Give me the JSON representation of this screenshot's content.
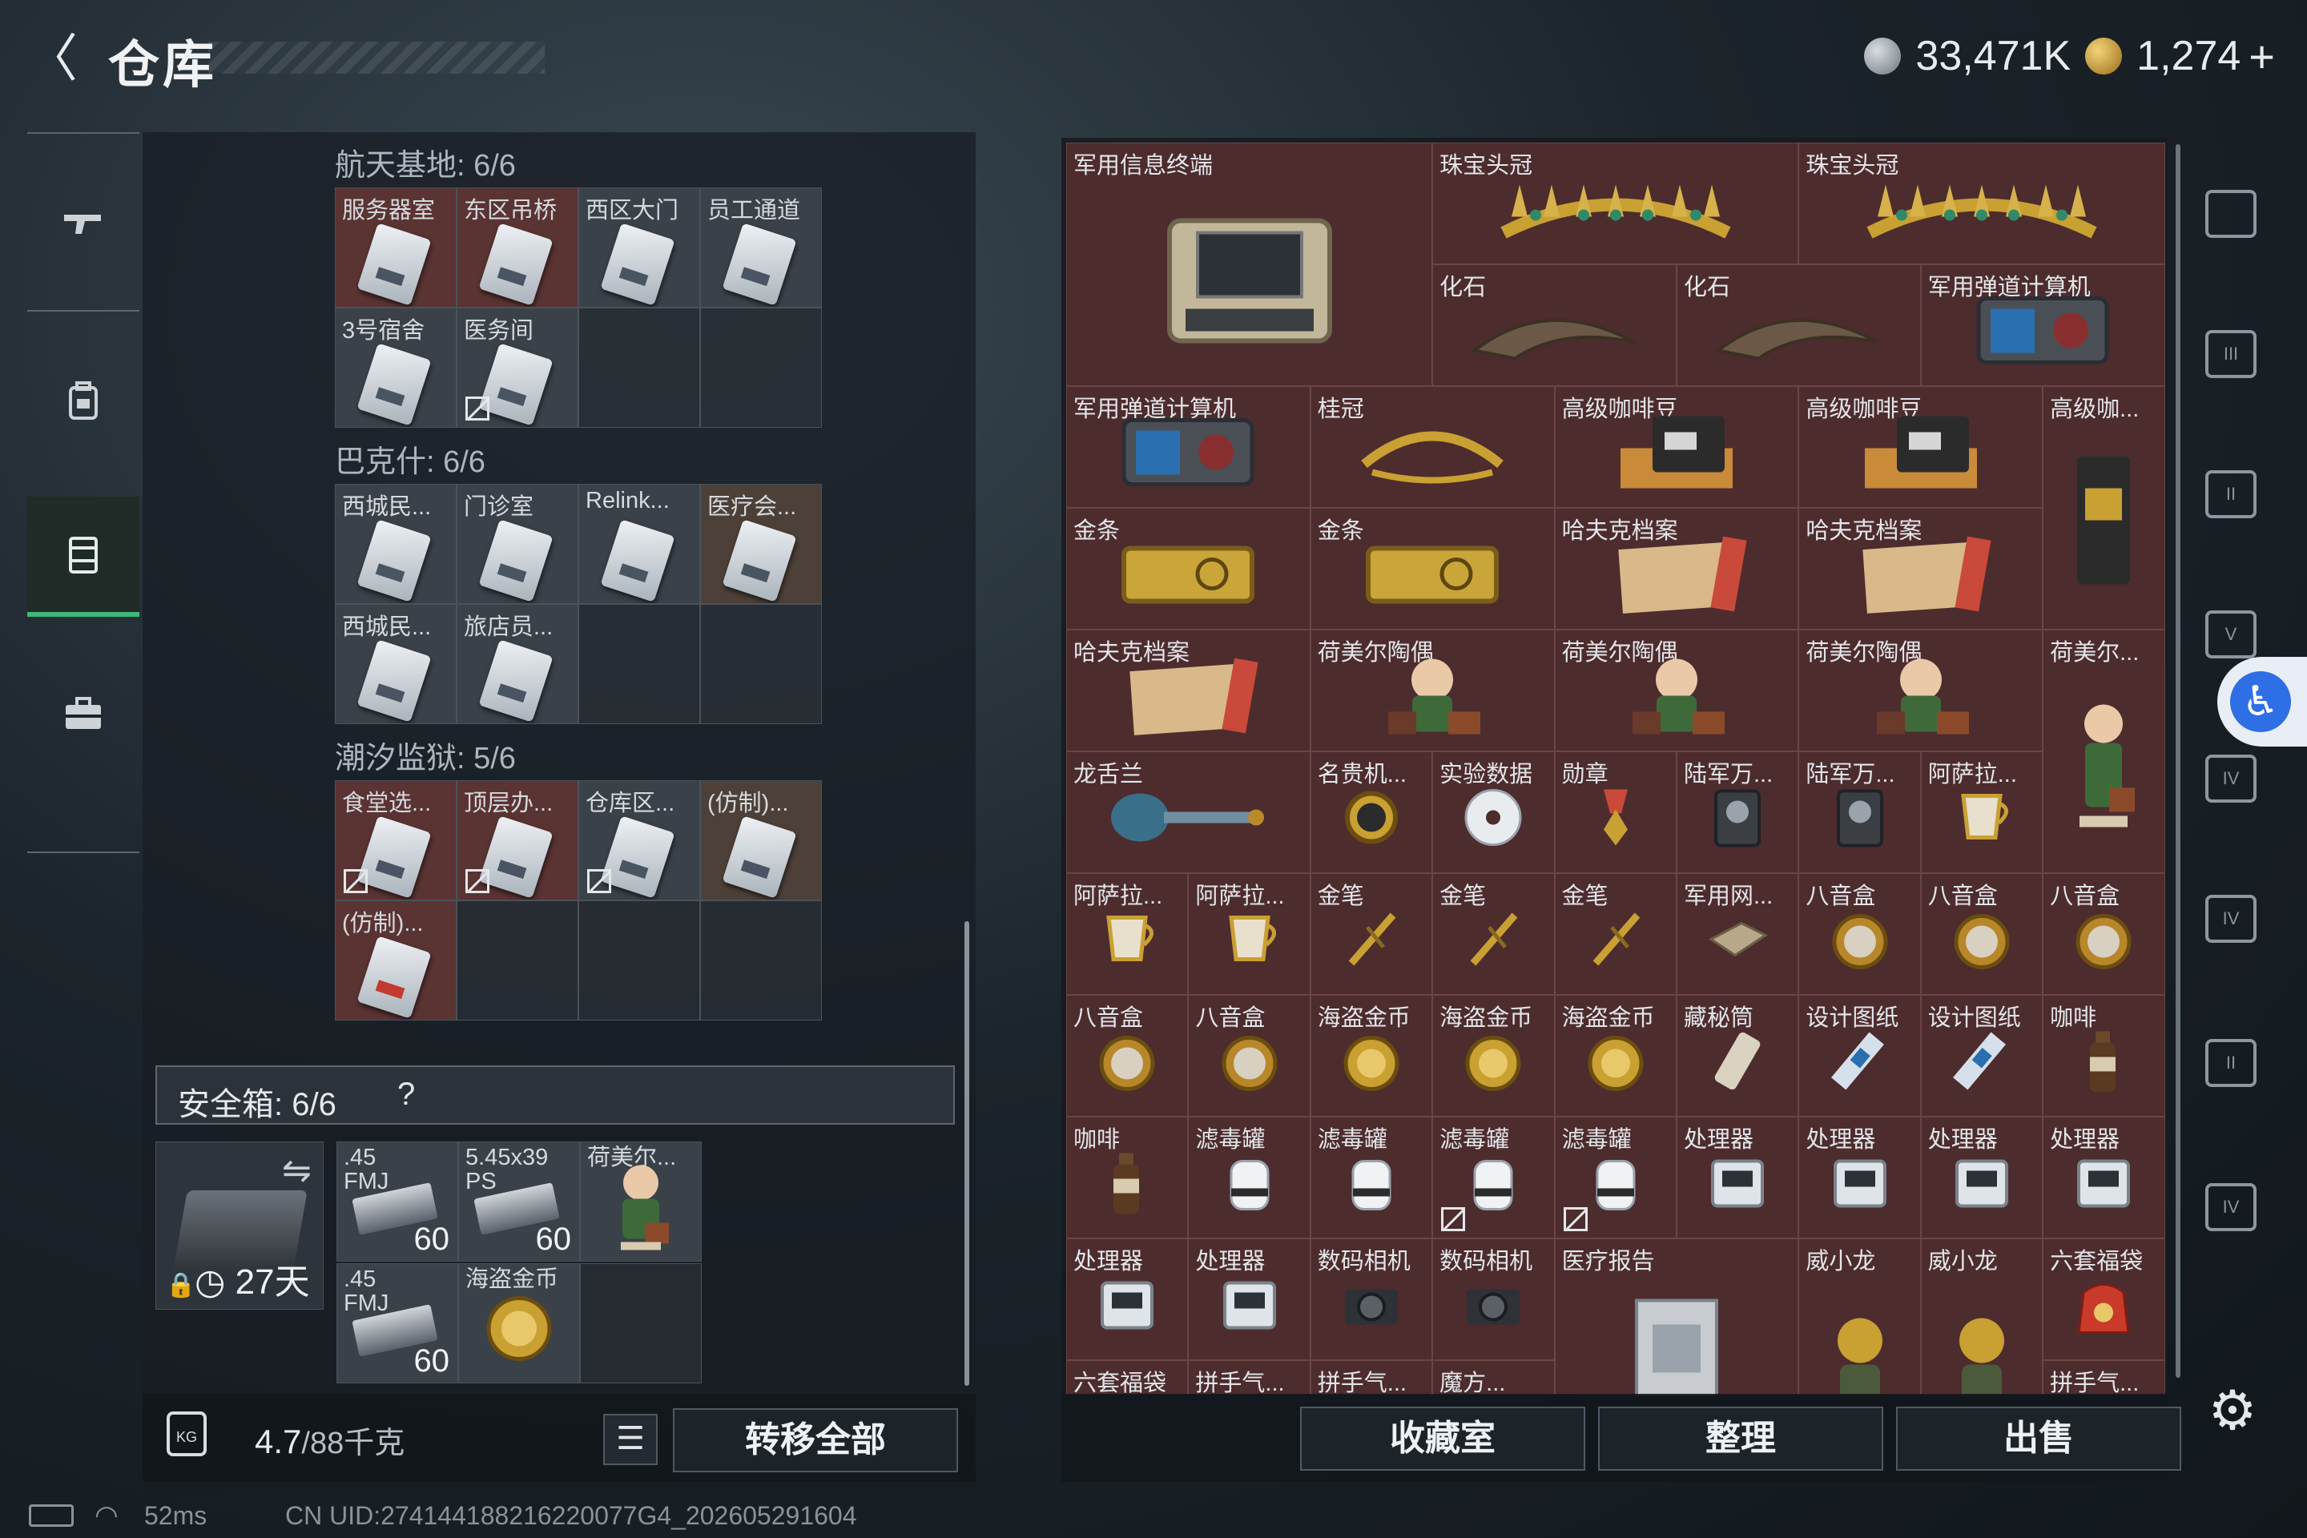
{
  "header": {
    "back_glyph": "〈",
    "title": "仓库",
    "currency_silver": "33,471K",
    "currency_gold": "1,274",
    "currency_plus": "+"
  },
  "left_nav": {
    "icons": [
      "gun-icon",
      "backpack-icon",
      "stash-icon",
      "toolbox-icon"
    ],
    "active_index": 2
  },
  "stash": {
    "sections": [
      {
        "title": "航天基地: 6/6",
        "cards": [
          {
            "label": "服务器室",
            "bg": "red",
            "nobind": false
          },
          {
            "label": "东区吊桥",
            "bg": "red",
            "nobind": false
          },
          {
            "label": "西区大门",
            "bg": "grey",
            "nobind": false
          },
          {
            "label": "员工通道",
            "bg": "grey",
            "nobind": false
          },
          {
            "label": "3号宿舍",
            "bg": "grey",
            "nobind": false
          },
          {
            "label": "医务间",
            "bg": "grey",
            "nobind": true
          }
        ]
      },
      {
        "title": "巴克什: 6/6",
        "cards": [
          {
            "label": "西城民...",
            "bg": "grey",
            "nobind": false
          },
          {
            "label": "门诊室",
            "bg": "grey",
            "nobind": false
          },
          {
            "label": "Relink...",
            "bg": "grey",
            "nobind": false
          },
          {
            "label": "医疗会...",
            "bg": "brown",
            "nobind": false
          },
          {
            "label": "西城民...",
            "bg": "grey",
            "nobind": false
          },
          {
            "label": "旅店员...",
            "bg": "grey",
            "nobind": false
          }
        ]
      },
      {
        "title": "潮汐监狱: 5/6",
        "cards": [
          {
            "label": "食堂选...",
            "bg": "red",
            "nobind": true
          },
          {
            "label": "顶层办...",
            "bg": "red",
            "nobind": true
          },
          {
            "label": "仓库区...",
            "bg": "grey",
            "nobind": true
          },
          {
            "label": "(仿制)...",
            "bg": "brown",
            "nobind": false
          },
          {
            "label": "(仿制)...",
            "bg": "red",
            "nobind": false,
            "red_card": true
          }
        ]
      }
    ]
  },
  "safebox": {
    "title": "安全箱:  6/6",
    "help": "?",
    "days": "27天",
    "swap_glyph": "⇋",
    "items": [
      {
        "label": ".45\nFMJ",
        "count": "60",
        "type": "ammo"
      },
      {
        "label": "5.45x39\nPS",
        "count": "60",
        "type": "ammo"
      },
      {
        "label": "荷美尔...",
        "count": "",
        "type": "figurine"
      },
      {
        "label": ".45\nFMJ",
        "count": "60",
        "type": "ammo"
      },
      {
        "label": "海盗金币",
        "count": "",
        "type": "coin"
      }
    ]
  },
  "bottom_left": {
    "kg_label": "KG",
    "weight_current": "4.7",
    "weight_max": "/88千克",
    "list_glyph": "☰",
    "transfer_all": "转移全部"
  },
  "loot_grid": [
    {
      "label": "军用信息终端",
      "col": 1,
      "row": 1,
      "w": 3,
      "h": 2,
      "pic": "terminal"
    },
    {
      "label": "珠宝头冠",
      "col": 4,
      "row": 1,
      "w": 3,
      "h": 1,
      "pic": "tiara"
    },
    {
      "label": "珠宝头冠",
      "col": 7,
      "row": 1,
      "w": 3,
      "h": 1,
      "pic": "tiara"
    },
    {
      "label": "化石",
      "col": 4,
      "row": 2,
      "w": 2,
      "h": 1,
      "pic": "fossil"
    },
    {
      "label": "化石",
      "col": 6,
      "row": 2,
      "w": 2,
      "h": 1,
      "pic": "fossil"
    },
    {
      "label": "军用弹道计算机",
      "col": 8,
      "row": 2,
      "w": 2,
      "h": 1,
      "pic": "computer"
    },
    {
      "label": "军用弹道计算机",
      "col": 1,
      "row": 3,
      "w": 2,
      "h": 1,
      "pic": "computer"
    },
    {
      "label": "桂冠",
      "col": 3,
      "row": 3,
      "w": 2,
      "h": 1,
      "pic": "laurel"
    },
    {
      "label": "高级咖啡豆",
      "col": 5,
      "row": 3,
      "w": 2,
      "h": 1,
      "pic": "coffeebag"
    },
    {
      "label": "高级咖啡豆",
      "col": 7,
      "row": 3,
      "w": 2,
      "h": 1,
      "pic": "coffeebag"
    },
    {
      "label": "高级咖...",
      "col": 9,
      "row": 3,
      "w": 1,
      "h": 2,
      "pic": "coffeebagtall"
    },
    {
      "label": "金条",
      "col": 1,
      "row": 4,
      "w": 2,
      "h": 1,
      "pic": "goldbar"
    },
    {
      "label": "金条",
      "col": 3,
      "row": 4,
      "w": 2,
      "h": 1,
      "pic": "goldbar"
    },
    {
      "label": "哈夫克档案",
      "col": 5,
      "row": 4,
      "w": 2,
      "h": 1,
      "pic": "file"
    },
    {
      "label": "哈夫克档案",
      "col": 7,
      "row": 4,
      "w": 2,
      "h": 1,
      "pic": "file"
    },
    {
      "label": "哈夫克档案",
      "col": 1,
      "row": 5,
      "w": 2,
      "h": 1,
      "pic": "file"
    },
    {
      "label": "荷美尔陶偶",
      "col": 3,
      "row": 5,
      "w": 2,
      "h": 1,
      "pic": "figurine"
    },
    {
      "label": "荷美尔陶偶",
      "col": 5,
      "row": 5,
      "w": 2,
      "h": 1,
      "pic": "figurine"
    },
    {
      "label": "荷美尔陶偶",
      "col": 7,
      "row": 5,
      "w": 2,
      "h": 1,
      "pic": "figurine"
    },
    {
      "label": "荷美尔...",
      "col": 9,
      "row": 5,
      "w": 1,
      "h": 2,
      "pic": "figurinetall"
    },
    {
      "label": "龙舌兰",
      "col": 1,
      "row": 6,
      "w": 2,
      "h": 1,
      "pic": "tequila"
    },
    {
      "label": "名贵机...",
      "col": 3,
      "row": 6,
      "w": 1,
      "h": 1,
      "pic": "watch"
    },
    {
      "label": "实验数据",
      "col": 4,
      "row": 6,
      "w": 1,
      "h": 1,
      "pic": "disc"
    },
    {
      "label": "勋章",
      "col": 5,
      "row": 6,
      "w": 1,
      "h": 1,
      "pic": "medal"
    },
    {
      "label": "陆军万...",
      "col": 6,
      "row": 6,
      "w": 1,
      "h": 1,
      "pic": "meter"
    },
    {
      "label": "陆军万...",
      "col": 7,
      "row": 6,
      "w": 1,
      "h": 1,
      "pic": "meter"
    },
    {
      "label": "阿萨拉...",
      "col": 8,
      "row": 6,
      "w": 1,
      "h": 1,
      "pic": "cup"
    },
    {
      "label": "阿萨拉...",
      "col": 1,
      "row": 7,
      "w": 1,
      "h": 1,
      "pic": "cup"
    },
    {
      "label": "阿萨拉...",
      "col": 2,
      "row": 7,
      "w": 1,
      "h": 1,
      "pic": "cup"
    },
    {
      "label": "金笔",
      "col": 3,
      "row": 7,
      "w": 1,
      "h": 1,
      "pic": "pen"
    },
    {
      "label": "金笔",
      "col": 4,
      "row": 7,
      "w": 1,
      "h": 1,
      "pic": "pen"
    },
    {
      "label": "金笔",
      "col": 5,
      "row": 7,
      "w": 1,
      "h": 1,
      "pic": "pen"
    },
    {
      "label": "军用网...",
      "col": 6,
      "row": 7,
      "w": 1,
      "h": 1,
      "pic": "router"
    },
    {
      "label": "八音盒",
      "col": 7,
      "row": 7,
      "w": 1,
      "h": 1,
      "pic": "musicbox"
    },
    {
      "label": "八音盒",
      "col": 8,
      "row": 7,
      "w": 1,
      "h": 1,
      "pic": "musicbox"
    },
    {
      "label": "八音盒",
      "col": 9,
      "row": 7,
      "w": 1,
      "h": 1,
      "pic": "musicbox"
    },
    {
      "label": "八音盒",
      "col": 1,
      "row": 8,
      "w": 1,
      "h": 1,
      "pic": "musicbox"
    },
    {
      "label": "八音盒",
      "col": 2,
      "row": 8,
      "w": 1,
      "h": 1,
      "pic": "musicbox"
    },
    {
      "label": "海盗金币",
      "col": 3,
      "row": 8,
      "w": 1,
      "h": 1,
      "pic": "coin"
    },
    {
      "label": "海盗金币",
      "col": 4,
      "row": 8,
      "w": 1,
      "h": 1,
      "pic": "coin"
    },
    {
      "label": "海盗金币",
      "col": 5,
      "row": 8,
      "w": 1,
      "h": 1,
      "pic": "coin"
    },
    {
      "label": "藏秘筒",
      "col": 6,
      "row": 8,
      "w": 1,
      "h": 1,
      "pic": "cylinder"
    },
    {
      "label": "设计图纸",
      "col": 7,
      "row": 8,
      "w": 1,
      "h": 1,
      "pic": "blueprint"
    },
    {
      "label": "设计图纸",
      "col": 8,
      "row": 8,
      "w": 1,
      "h": 1,
      "pic": "blueprint"
    },
    {
      "label": "咖啡",
      "col": 9,
      "row": 8,
      "w": 1,
      "h": 1,
      "pic": "bottle"
    },
    {
      "label": "咖啡",
      "col": 1,
      "row": 9,
      "w": 1,
      "h": 1,
      "pic": "bottle"
    },
    {
      "label": "滤毒罐",
      "col": 2,
      "row": 9,
      "w": 1,
      "h": 1,
      "pic": "filter"
    },
    {
      "label": "滤毒罐",
      "col": 3,
      "row": 9,
      "w": 1,
      "h": 1,
      "pic": "filter"
    },
    {
      "label": "滤毒罐",
      "col": 4,
      "row": 9,
      "w": 1,
      "h": 1,
      "pic": "filter",
      "nobind": true
    },
    {
      "label": "滤毒罐",
      "col": 5,
      "row": 9,
      "w": 1,
      "h": 1,
      "pic": "filter",
      "nobind": true
    },
    {
      "label": "处理器",
      "col": 6,
      "row": 9,
      "w": 1,
      "h": 1,
      "pic": "cpu"
    },
    {
      "label": "处理器",
      "col": 7,
      "row": 9,
      "w": 1,
      "h": 1,
      "pic": "cpu"
    },
    {
      "label": "处理器",
      "col": 8,
      "row": 9,
      "w": 1,
      "h": 1,
      "pic": "cpu"
    },
    {
      "label": "处理器",
      "col": 9,
      "row": 9,
      "w": 1,
      "h": 1,
      "pic": "cpu"
    },
    {
      "label": "处理器",
      "col": 1,
      "row": 10,
      "w": 1,
      "h": 1,
      "pic": "cpu"
    },
    {
      "label": "处理器",
      "col": 2,
      "row": 10,
      "w": 1,
      "h": 1,
      "pic": "cpu"
    },
    {
      "label": "数码相机",
      "col": 3,
      "row": 10,
      "w": 1,
      "h": 1,
      "pic": "camera"
    },
    {
      "label": "数码相机",
      "col": 4,
      "row": 10,
      "w": 1,
      "h": 1,
      "pic": "camera"
    },
    {
      "label": "医疗报告",
      "col": 5,
      "row": 10,
      "w": 2,
      "h": 2,
      "pic": "report"
    },
    {
      "label": "威小龙",
      "col": 7,
      "row": 10,
      "w": 1,
      "h": 2,
      "pic": "dragon"
    },
    {
      "label": "威小龙",
      "col": 8,
      "row": 10,
      "w": 1,
      "h": 2,
      "pic": "dragon"
    },
    {
      "label": "六套福袋",
      "col": 9,
      "row": 10,
      "w": 1,
      "h": 1,
      "pic": "luckybag"
    },
    {
      "label": "六套福袋",
      "col": 1,
      "row": 11,
      "w": 1,
      "h": 1,
      "pic": "luckybag"
    },
    {
      "label": "拼手气...",
      "col": 2,
      "row": 11,
      "w": 1,
      "h": 1,
      "pic": "luckybag"
    },
    {
      "label": "拼手气...",
      "col": 3,
      "row": 11,
      "w": 1,
      "h": 1,
      "pic": "luckybag"
    },
    {
      "label": "魔方...",
      "col": 4,
      "row": 11,
      "w": 1,
      "h": 1,
      "pic": "cube"
    },
    {
      "label": "拼手气...",
      "col": 9,
      "row": 11,
      "w": 1,
      "h": 1,
      "pic": "luckybag"
    }
  ],
  "right_buttons": {
    "collection": "收藏室",
    "sort": "整理",
    "sell": "出售"
  },
  "right_side_nav": [
    {
      "name": "stash-tab-1-icon",
      "label": ""
    },
    {
      "name": "stash-tab-III-icon",
      "label": "III"
    },
    {
      "name": "stash-tab-II-icon",
      "label": "II"
    },
    {
      "name": "stash-tab-V-icon",
      "label": "V"
    },
    {
      "name": "stash-tab-IV-icon",
      "label": "IV"
    },
    {
      "name": "stash-tab-IV-b-icon",
      "label": "IV"
    },
    {
      "name": "stash-tab-II-b-icon",
      "label": "II"
    },
    {
      "name": "stash-tab-IV-c-icon",
      "label": "IV"
    }
  ],
  "status": {
    "ping": "52ms",
    "uid": "CN UID:274144188216220077G4_202605291604"
  },
  "colors": {
    "active_nav": "#3fb87b",
    "item_bg": "#4d2c2e",
    "accessibility": "#2e6fe6"
  }
}
